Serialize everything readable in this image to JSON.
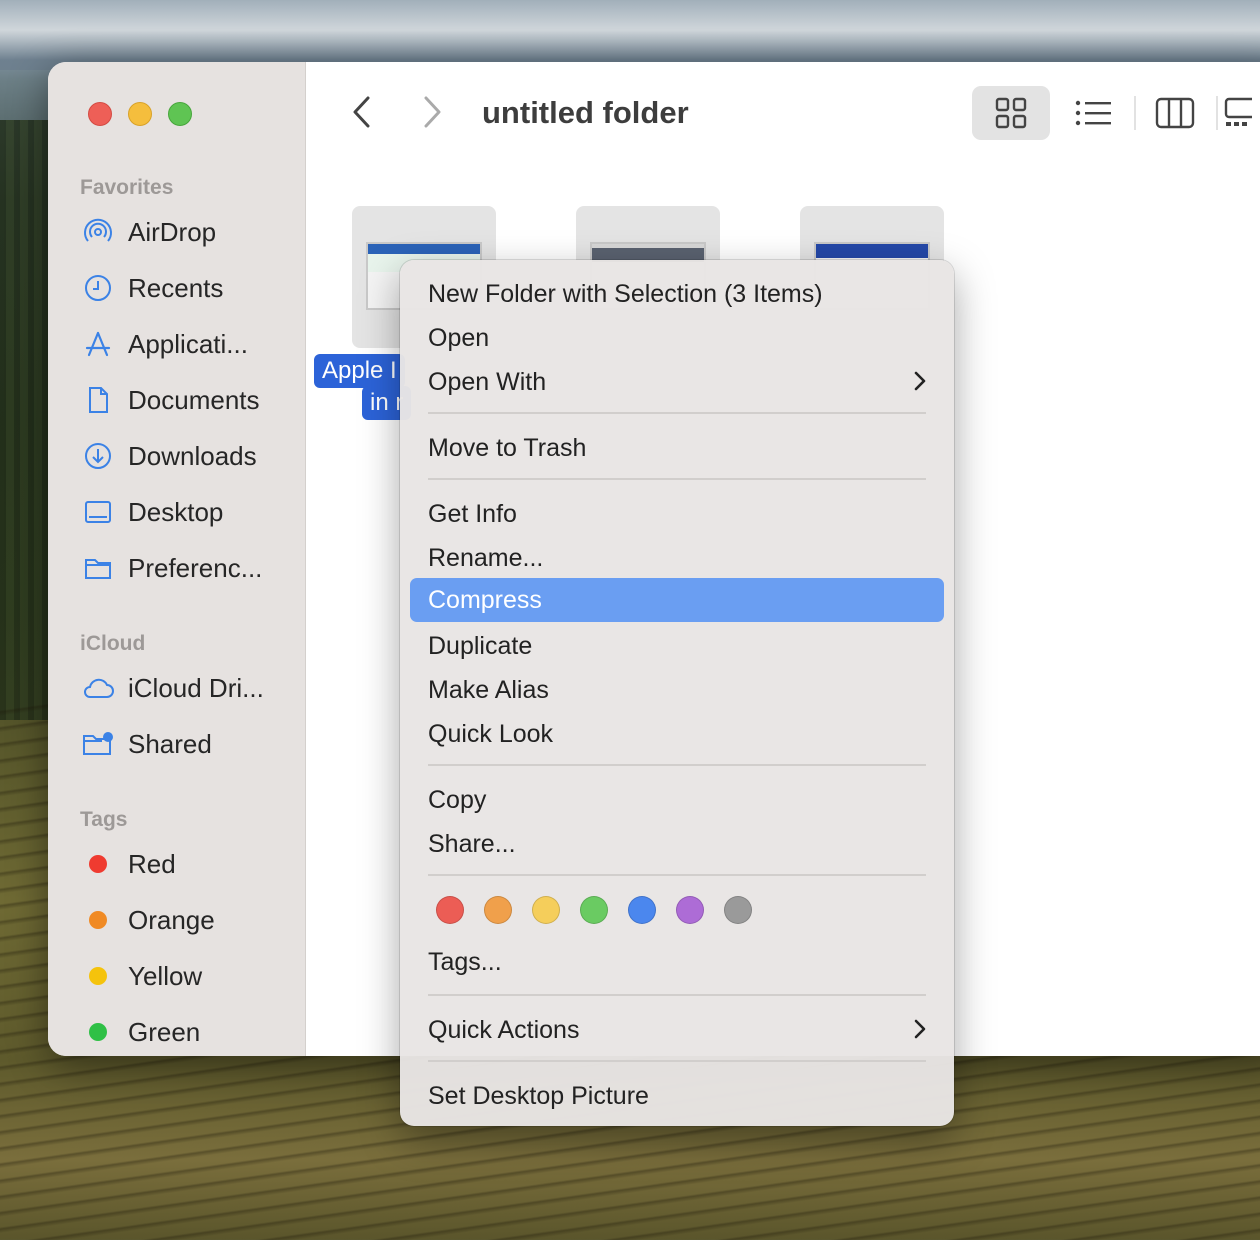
{
  "window": {
    "title": "untitled folder"
  },
  "sidebar": {
    "favorites_title": "Favorites",
    "favorites": [
      {
        "label": "AirDrop",
        "icon": "airdrop-icon"
      },
      {
        "label": "Recents",
        "icon": "clock-icon"
      },
      {
        "label": "Applicati...",
        "icon": "applications-icon"
      },
      {
        "label": "Documents",
        "icon": "document-icon"
      },
      {
        "label": "Downloads",
        "icon": "download-icon"
      },
      {
        "label": "Desktop",
        "icon": "desktop-icon"
      },
      {
        "label": "Preferenc...",
        "icon": "folder-icon"
      }
    ],
    "icloud_title": "iCloud",
    "icloud": [
      {
        "label": "iCloud Dri...",
        "icon": "cloud-icon"
      },
      {
        "label": "Shared",
        "icon": "shared-folder-icon"
      }
    ],
    "tags_title": "Tags",
    "tags": [
      {
        "label": "Red",
        "color": "#ef3b30"
      },
      {
        "label": "Orange",
        "color": "#f08a24"
      },
      {
        "label": "Yellow",
        "color": "#f5c30c"
      },
      {
        "label": "Green",
        "color": "#2fc046"
      }
    ]
  },
  "files": {
    "selected_label_line1": "Apple I",
    "selected_label_line2": "in r"
  },
  "context_menu": {
    "items": {
      "new_folder": "New Folder with Selection (3 Items)",
      "open": "Open",
      "open_with": "Open With",
      "move_to_trash": "Move to Trash",
      "get_info": "Get Info",
      "rename": "Rename...",
      "compress": "Compress",
      "duplicate": "Duplicate",
      "make_alias": "Make Alias",
      "quick_look": "Quick Look",
      "copy": "Copy",
      "share": "Share...",
      "tags": "Tags...",
      "quick_actions": "Quick Actions",
      "set_desktop_picture": "Set Desktop Picture"
    },
    "highlighted": "Compress",
    "tag_colors": [
      "#ec5d55",
      "#f0a04b",
      "#f5ce5b",
      "#6acb62",
      "#4b87ee",
      "#ad6cd6",
      "#9a9a9a"
    ]
  }
}
